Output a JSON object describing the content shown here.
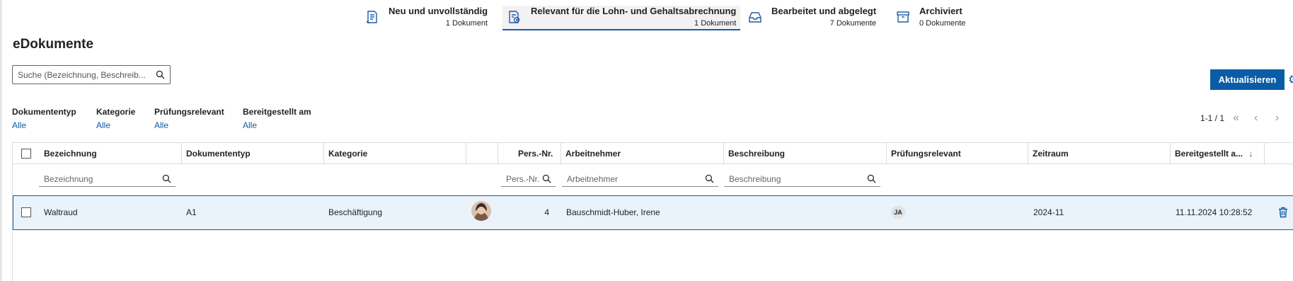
{
  "status_tabs": [
    {
      "title": "Neu und unvollständig",
      "count": "1 Dokument",
      "icon": "document-edit-icon"
    },
    {
      "title": "Relevant für die Lohn- und Gehaltsabrechnung",
      "count": "1 Dokument",
      "icon": "payroll-document-icon",
      "active": true
    },
    {
      "title": "Bearbeitet und abgelegt",
      "count": "7 Dokumente",
      "icon": "inbox-tray-icon"
    },
    {
      "title": "Archiviert",
      "count": "0 Dokumente",
      "icon": "archive-box-icon"
    }
  ],
  "page_title": "eDokumente",
  "search": {
    "placeholder": "Suche (Bezeichnung, Beschreib...",
    "icon": "search-icon"
  },
  "toolbar": {
    "refresh_label": "Aktualisieren",
    "settings_icon": "gear-icon"
  },
  "filters": [
    {
      "label": "Dokumententyp",
      "value": "Alle"
    },
    {
      "label": "Kategorie",
      "value": "Alle"
    },
    {
      "label": "Prüfungsrelevant",
      "value": "Alle"
    },
    {
      "label": "Bereitgestellt am",
      "value": "Alle"
    }
  ],
  "pagination": {
    "range": "1-1 / 1"
  },
  "table": {
    "columns": [
      "Bezeichnung",
      "Dokumententyp",
      "Kategorie",
      "",
      "Pers.-Nr.",
      "Arbeitnehmer",
      "Beschreibung",
      "Prüfungsrelevant",
      "Zeitraum",
      "Bereitgestellt a..."
    ],
    "sort_indicator": "↓",
    "filter_placeholders": {
      "bezeichnung": "Bezeichnung",
      "persnr": "Pers.-Nr.",
      "arbeitnehmer": "Arbeitnehmer",
      "beschreibung": "Beschreibung"
    },
    "rows": [
      {
        "bezeichnung": "Waltraud",
        "dokumententyp": "A1",
        "kategorie": "Beschäftigung",
        "persnr": "4",
        "arbeitnehmer": "Bauschmidt-Huber, Irene",
        "beschreibung": "",
        "pruefungsrelevant": "JA",
        "zeitraum": "2024-11",
        "bereitgestellt": "11.11.2024 10:28:52"
      }
    ]
  },
  "colors": {
    "accent": "#0b5ca6",
    "row_selected": "#eaf3fa"
  }
}
